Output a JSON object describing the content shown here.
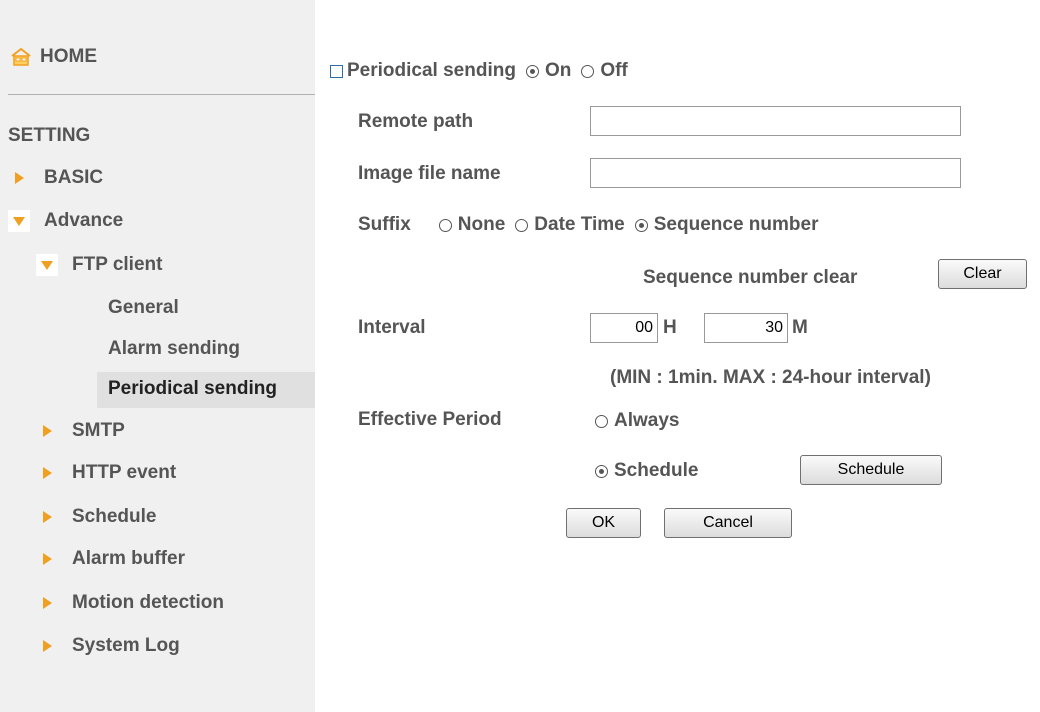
{
  "sidebar": {
    "home_label": "HOME",
    "setting_title": "SETTING",
    "basic": "BASIC",
    "advance": "Advance",
    "ftp_client": "FTP client",
    "ftp_children": [
      "General",
      "Alarm sending",
      "Periodical sending"
    ],
    "others": [
      "SMTP",
      "HTTP event",
      "Schedule",
      "Alarm buffer",
      "Motion detection",
      "System Log"
    ],
    "accent_color": "#f0a020"
  },
  "form": {
    "periodical_sending_label": "Periodical sending",
    "on_label": "On",
    "off_label": "Off",
    "remote_path_label": "Remote path",
    "remote_path_value": "",
    "image_file_name_label": "Image file name",
    "image_file_name_value": "",
    "suffix_label": "Suffix",
    "suffix_none": "None",
    "suffix_date_time": "Date Time",
    "suffix_sequence": "Sequence number",
    "sequence_clear_label": "Sequence number clear",
    "clear_button": "Clear",
    "interval_label": "Interval",
    "interval_hours": "00",
    "hours_unit": "H",
    "interval_minutes": "30",
    "minutes_unit": "M",
    "interval_note": "(MIN : 1min. MAX : 24-hour interval)",
    "effective_period_label": "Effective Period",
    "always_label": "Always",
    "schedule_label": "Schedule",
    "schedule_button": "Schedule",
    "ok_button": "OK",
    "cancel_button": "Cancel"
  }
}
